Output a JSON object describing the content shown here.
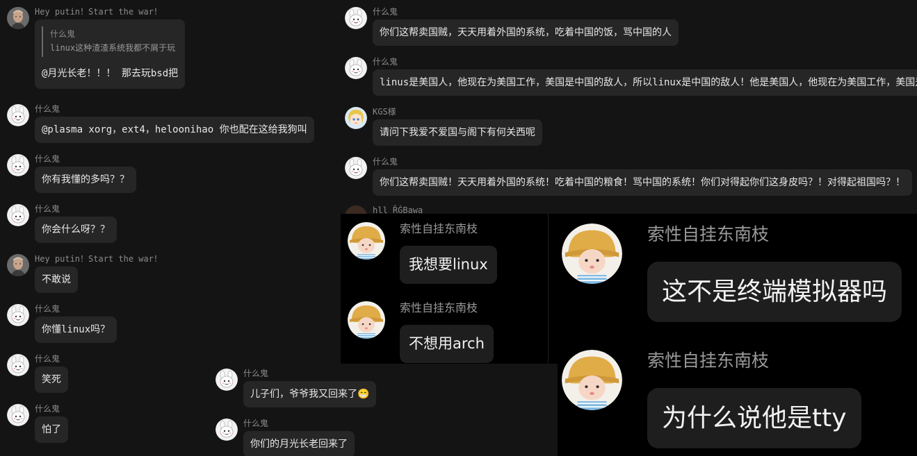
{
  "panel_a": {
    "messages": [
      {
        "sender": "Hey putin！Start the war！",
        "quote": {
          "name": "什么鬼",
          "text": "linux这种渣渣系统我都不屑于玩"
        },
        "text": "@月光长老！！！ 那去玩bsd把",
        "avatar": "man-photo-avatar"
      },
      {
        "sender": "什么鬼",
        "text": "@plasma xorg，ext4，heloonihao 你也配在这给我狗叫",
        "avatar": "cartoon-bunny-avatar"
      },
      {
        "sender": "什么鬼",
        "text": "你有我懂的多吗？？",
        "avatar": "cartoon-bunny-avatar"
      },
      {
        "sender": "什么鬼",
        "text": "你会什么呀？？",
        "avatar": "cartoon-bunny-avatar"
      },
      {
        "sender": "Hey putin！Start the war！",
        "text": "不敢说",
        "avatar": "man-photo-avatar"
      },
      {
        "sender": "什么鬼",
        "text": "你懂linux吗？",
        "avatar": "cartoon-bunny-avatar"
      },
      {
        "sender": "什么鬼",
        "text": "笑死",
        "avatar": "cartoon-bunny-avatar"
      },
      {
        "sender": "什么鬼",
        "text": "怕了",
        "avatar": "cartoon-bunny-avatar"
      }
    ]
  },
  "panel_b": {
    "messages": [
      {
        "sender": "什么鬼",
        "text": "你们这帮卖国贼，天天用着外国的系统，吃着中国的饭，骂中国的人",
        "avatar": "cartoon-bunny-avatar"
      },
      {
        "sender": "什么鬼",
        "text": "linus是美国人，他现在为美国工作，美国是中国的敌人，所以linux是中国的敌人！他是美国人，他现在为美国工作，美国是",
        "avatar": "cartoon-bunny-avatar"
      },
      {
        "sender": "KGS様",
        "text": "请问下我爱不爱国与阁下有何关西呢",
        "avatar": "anime-girl-avatar"
      },
      {
        "sender": "什么鬼",
        "text": "你们这帮卖国贼！天天用着外国的系统！吃着中国的粮食！骂中国的系统！你们对得起你们这身皮吗？！对得起祖国吗？！",
        "avatar": "cartoon-bunny-avatar"
      }
    ],
    "partial_sender": "hll ŘĠBawa"
  },
  "panel_c": {
    "messages": [
      {
        "sender": "索性自挂东南枝",
        "text": "我想要linux",
        "avatar": "child-yellow-hat-avatar"
      },
      {
        "sender": "索性自挂东南枝",
        "text": "不想用arch",
        "avatar": "child-yellow-hat-avatar"
      }
    ]
  },
  "panel_d": {
    "messages": [
      {
        "sender": "索性自挂东南枝",
        "text": "这不是终端模拟器吗",
        "avatar": "child-yellow-hat-avatar"
      },
      {
        "sender": "索性自挂东南枝",
        "text": "为什么说他是tty",
        "avatar": "child-yellow-hat-avatar"
      }
    ]
  },
  "panel_e": {
    "messages": [
      {
        "sender": "什么鬼",
        "text": "儿子们，爷爷我又回来了",
        "emoji": "😁",
        "avatar": "cartoon-bunny-avatar"
      },
      {
        "sender": "什么鬼",
        "text": "你们的月光长老回来了",
        "avatar": "cartoon-bunny-avatar"
      }
    ]
  }
}
